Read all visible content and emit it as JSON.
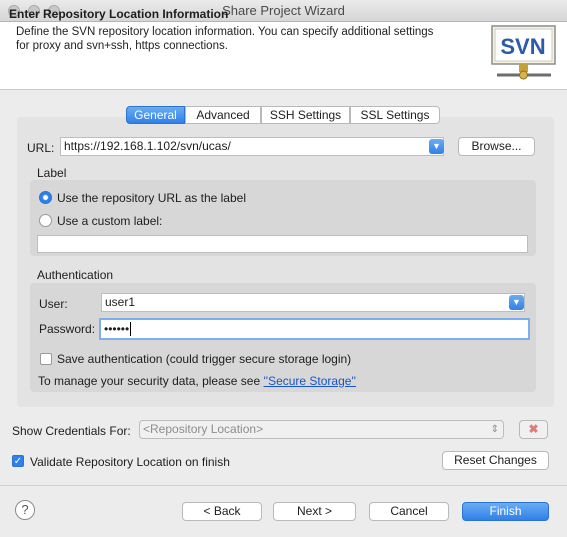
{
  "window": {
    "title": "Share Project Wizard"
  },
  "header": {
    "title": "Enter Repository Location Information",
    "description": "Define the SVN repository location information. You can specify additional settings for proxy and svn+ssh, https connections.",
    "logo_text": "SVN"
  },
  "tabs": [
    {
      "label": "General",
      "active": true
    },
    {
      "label": "Advanced",
      "active": false
    },
    {
      "label": "SSH Settings",
      "active": false
    },
    {
      "label": "SSL Settings",
      "active": false
    }
  ],
  "url": {
    "label": "URL:",
    "value": "https://192.168.1.102/svn/ucas/",
    "browse_label": "Browse..."
  },
  "label_group": {
    "title": "Label",
    "option_repo_url": "Use the repository URL as the label",
    "option_custom": "Use a custom label:",
    "selected": "repo_url",
    "custom_value": ""
  },
  "auth": {
    "title": "Authentication",
    "user_label": "User:",
    "user_value": "user1",
    "password_label": "Password:",
    "password_value": "••••••",
    "save_label": "Save authentication (could trigger secure storage login)",
    "save_checked": false,
    "storage_text": "To manage your security data, please see",
    "storage_link": "''Secure Storage''"
  },
  "credentials": {
    "label": "Show Credentials For:",
    "placeholder": "<Repository Location>"
  },
  "validate": {
    "label": "Validate Repository Location on finish",
    "checked": true
  },
  "reset_label": "Reset Changes",
  "footer": {
    "help_icon": "?",
    "back_label": "< Back",
    "next_label": "Next >",
    "cancel_label": "Cancel",
    "finish_label": "Finish"
  },
  "colors": {
    "accent": "#2f80e8",
    "link": "#1a55c4"
  }
}
